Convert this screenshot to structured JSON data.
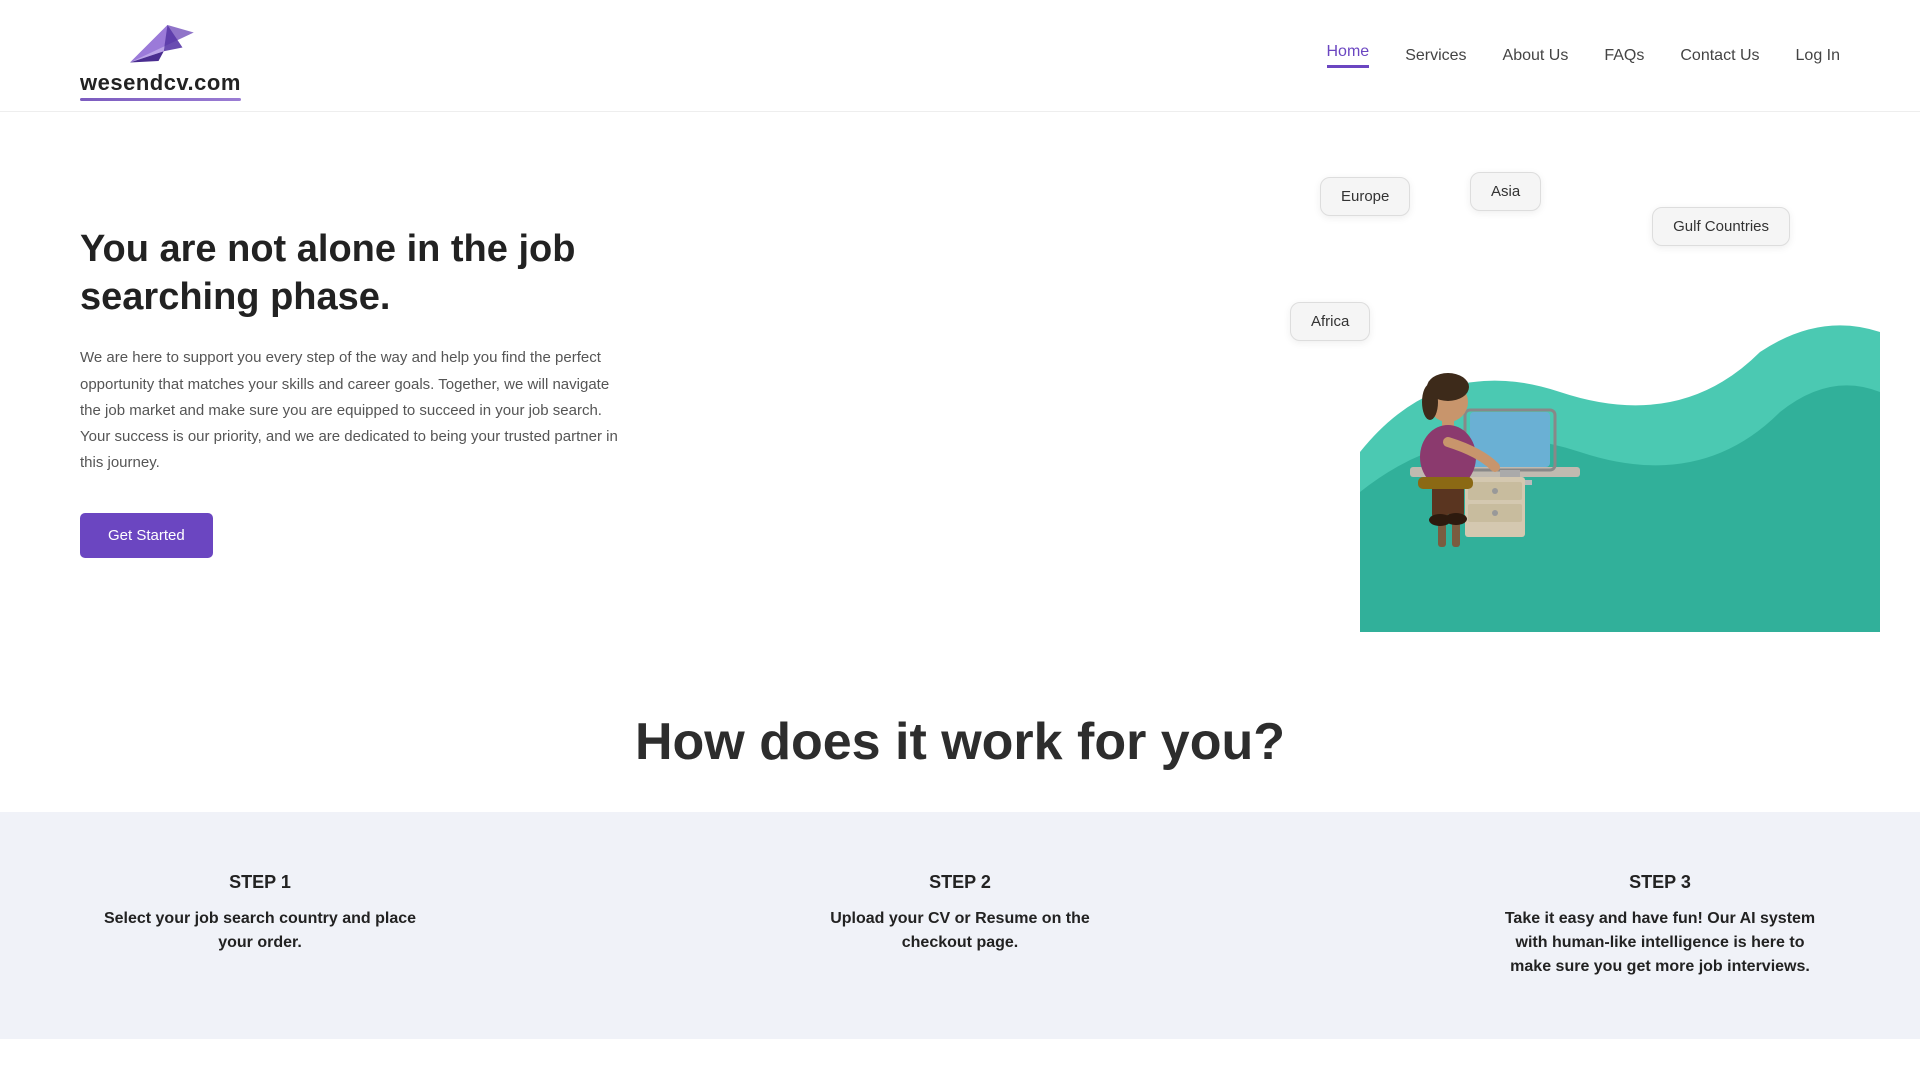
{
  "header": {
    "logo_text": "wesendcv.com",
    "nav_items": [
      {
        "label": "Home",
        "active": true
      },
      {
        "label": "Services",
        "active": false
      },
      {
        "label": "About Us",
        "active": false
      },
      {
        "label": "FAQs",
        "active": false
      },
      {
        "label": "Contact Us",
        "active": false
      },
      {
        "label": "Log In",
        "active": false
      }
    ]
  },
  "hero": {
    "title": "You are not alone in the job searching phase.",
    "description": "We are here to support you every step of the way and help you find the perfect opportunity that matches your skills and career goals. Together, we will navigate the job market and make sure you are equipped to succeed in your job search. Your success is our priority, and we are dedicated to being your trusted partner in this journey.",
    "cta_button": "Get Started",
    "bubbles": [
      {
        "label": "Europe"
      },
      {
        "label": "Asia"
      },
      {
        "label": "Gulf Countries"
      },
      {
        "label": "Africa"
      }
    ]
  },
  "how_section": {
    "title": "How does it work for you?"
  },
  "steps": [
    {
      "step_label": "STEP 1",
      "desc": "Select your job search country and place your order."
    },
    {
      "step_label": "STEP 2",
      "desc": "Upload your CV or Resume on the checkout page."
    },
    {
      "step_label": "STEP 3",
      "desc": "Take it easy and have fun! Our AI system with human-like intelligence is here to make sure you get more job interviews."
    }
  ],
  "colors": {
    "accent": "#6b46c1",
    "teal": "#2bbfa4",
    "bg_steps": "#f0f2f8"
  }
}
